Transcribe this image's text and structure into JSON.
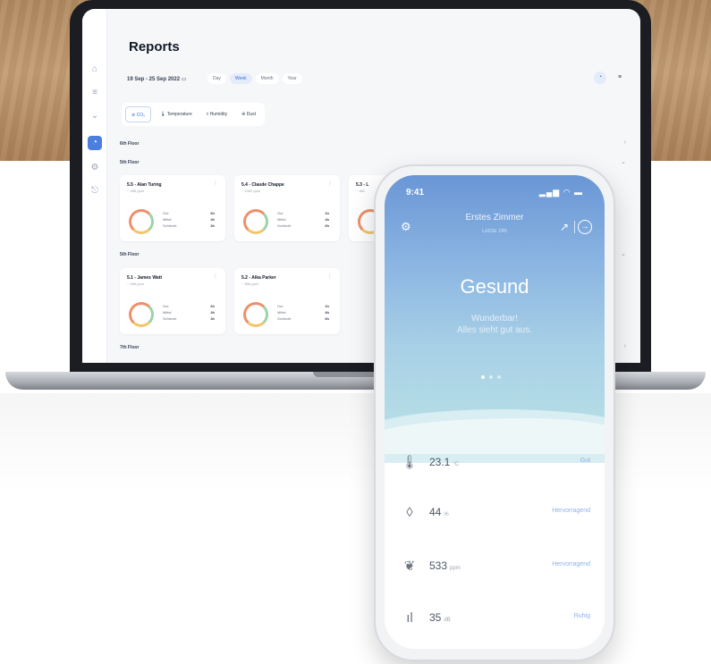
{
  "laptop": {
    "reports": {
      "title": "Reports",
      "date_range": "19 Sep - 25 Sep 2022",
      "period_tabs": [
        "Day",
        "Week",
        "Month",
        "Year"
      ],
      "period_selected": 1,
      "metric_tabs": [
        "CO₂",
        "Temperature",
        "Humidity",
        "Dust"
      ],
      "metric_selected": 0,
      "floors": [
        {
          "label": "6th Floor"
        },
        {
          "label": "5th Floor",
          "rooms": [
            {
              "name": "5.5 - Alan Turing",
              "sub": "~ 456 ppm",
              "legend": [
                "Gut",
                "Mittel",
                "Schlecht"
              ],
              "values": [
                "6h",
                "4h",
                "3h"
              ]
            },
            {
              "name": "5.4 - Claude Chappe",
              "sub": "~ 1082 ppm",
              "legend": [
                "Gut",
                "Mittel",
                "Schlecht"
              ],
              "values": [
                "1h",
                "4h",
                "6h"
              ]
            },
            {
              "name": "5.3 - L",
              "sub": "~ 481"
            }
          ]
        },
        {
          "label": "5th Floor",
          "rooms": [
            {
              "name": "5.1 - James Watt",
              "sub": "~ 456 ppm",
              "legend": [
                "Gut",
                "Mittel",
                "Schlecht"
              ],
              "values": [
                "6h",
                "4h",
                "3h"
              ]
            },
            {
              "name": "5.2 - Alka Parker",
              "sub": "~ 856 ppm",
              "legend": [
                "Gut",
                "Mittel",
                "Schlecht"
              ],
              "values": [
                "1h",
                "4h",
                "6h"
              ]
            }
          ]
        },
        {
          "label": "7th Floor"
        }
      ]
    }
  },
  "phone": {
    "time": "9:41",
    "status_icons": "▂▄▆ ◠ ▬",
    "room_title": "Erstes Zimmer",
    "room_subtitle": "Letzte 24h",
    "air_status": "Gesund",
    "message_line1": "Wunderbar!",
    "message_line2": "Alles sieht gut aus.",
    "page_dots": 3,
    "page_active": 0,
    "readings": [
      {
        "icon": "thermometer-icon",
        "glyph": "🌡",
        "value": "23.1",
        "unit": "°C",
        "rating": "Gut"
      },
      {
        "icon": "droplet-icon",
        "glyph": "💧",
        "value": "44",
        "unit": "%",
        "rating": "Hervorragend"
      },
      {
        "icon": "leaf-icon",
        "glyph": "🍃",
        "value": "533",
        "unit": "ppm",
        "rating": "Hervorragend"
      },
      {
        "icon": "noise-icon",
        "glyph": "📶",
        "value": "35",
        "unit": "dB",
        "rating": "Ruhig"
      }
    ]
  }
}
